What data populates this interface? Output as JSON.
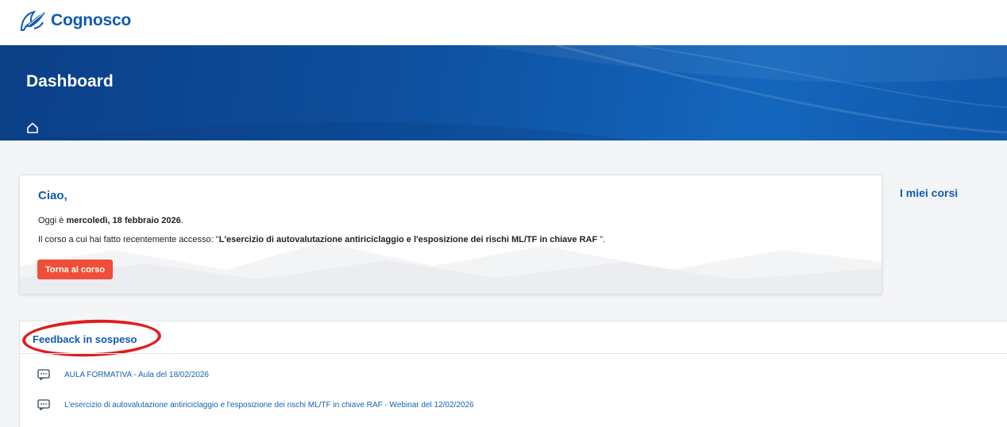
{
  "brand": {
    "name": "Cognosco",
    "color": "#0f5bb0"
  },
  "hero": {
    "title": "Dashboard",
    "home_icon": "home-icon"
  },
  "welcome": {
    "greeting": "Ciao,",
    "date_prefix": "Oggi è ",
    "date_value": "mercoledì, 18 febbraio 2026",
    "date_suffix": ".",
    "recent_prefix": "Il corso a cui hai fatto recentemente accesso: \"",
    "recent_course": "L'esercizio di autovalutazione antiriciclaggio e l'esposizione dei rischi ML/TF in chiave RAF",
    "recent_suffix": " \".",
    "button_label": "Torna al corso",
    "button_color": "#f04e37"
  },
  "side": {
    "my_courses": "I miei corsi"
  },
  "feedback": {
    "title": "Feedback in sospeso",
    "highlight_color": "#e01d1d",
    "items": [
      {
        "icon": "chat-icon",
        "label": "AULA FORMATIVA - Aula del 18/02/2026"
      },
      {
        "icon": "chat-icon",
        "label": "L'esercizio di autovalutazione antiriciclaggio e l'esposizione dei rischi ML/TF in chiave RAF - Webinar del 12/02/2026"
      }
    ]
  }
}
